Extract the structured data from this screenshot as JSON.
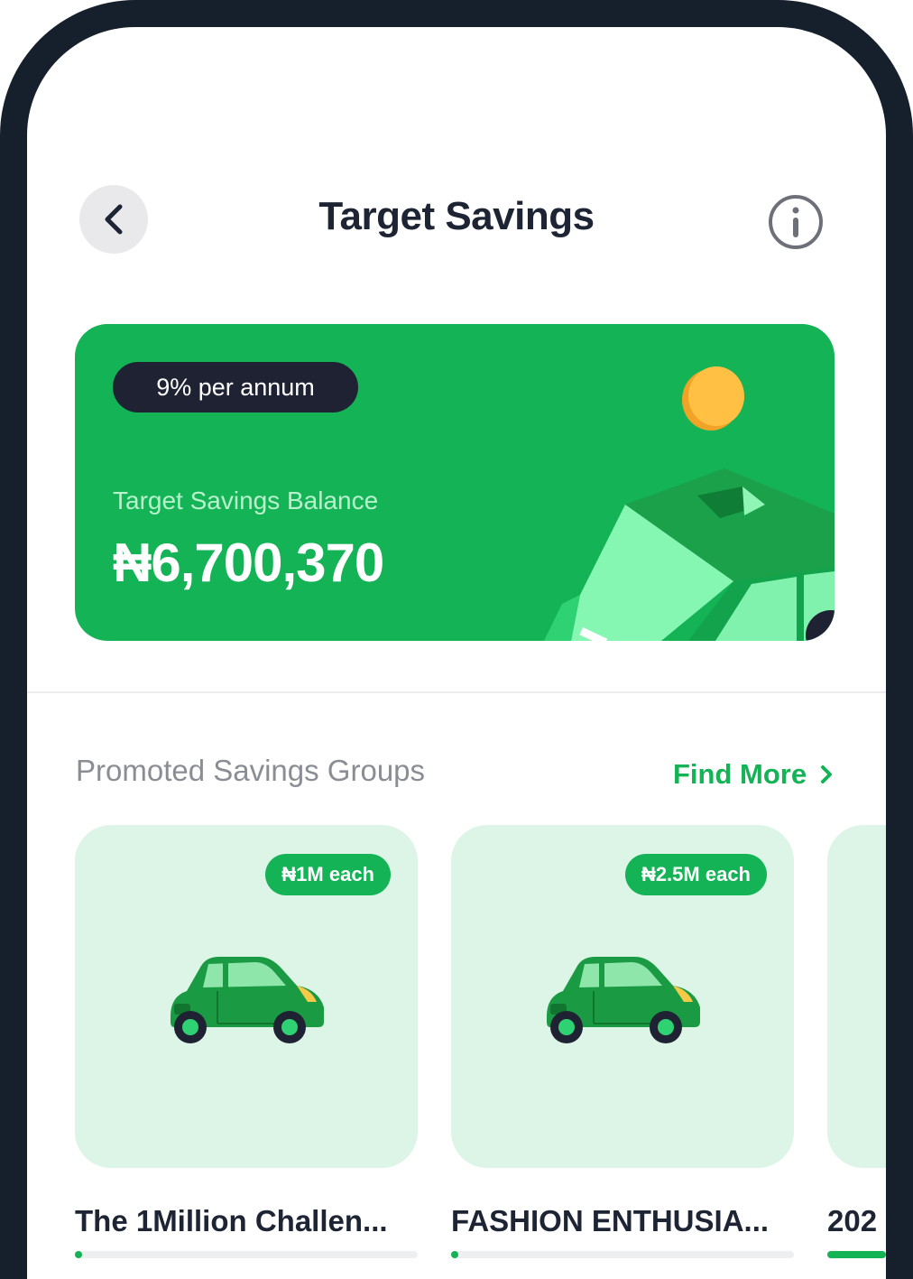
{
  "header": {
    "title": "Target Savings",
    "back_icon": "chevron-left-icon",
    "info_icon": "info-icon"
  },
  "balance_card": {
    "rate": "9% per annum",
    "label": "Target Savings Balance",
    "amount": "₦6,700,370"
  },
  "promoted": {
    "title": "Promoted Savings Groups",
    "find_more": "Find More",
    "groups": [
      {
        "badge": "₦1M each",
        "name": "The 1Million Challen...",
        "progress": 0.02
      },
      {
        "badge": "₦2.5M each",
        "name": "FASHION ENTHUSIA...",
        "progress": 0.02
      },
      {
        "badge": "",
        "name": "202",
        "progress": 1.0
      }
    ]
  },
  "colors": {
    "frame": "#16202d",
    "accent_green": "#13b356",
    "card_mint": "#dcf5e6",
    "pill_dark": "#1f2233"
  }
}
